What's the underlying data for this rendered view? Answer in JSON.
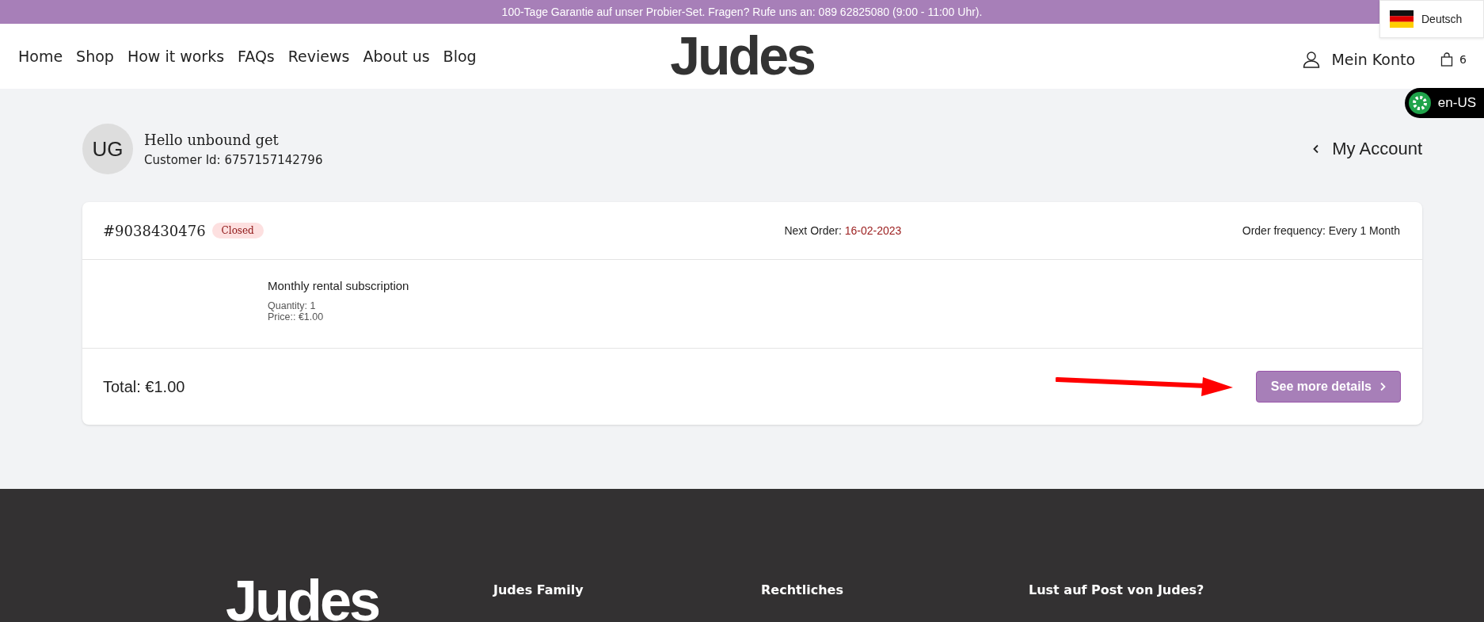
{
  "announcement": "100-Tage Garantie auf unser Probier-Set. Fragen? Rufe uns an: 089 62825080 (9:00 - 11:00 Uhr).",
  "language_switcher": {
    "label": "Deutsch"
  },
  "nav": [
    "Home",
    "Shop",
    "How it works",
    "FAQs",
    "Reviews",
    "About us",
    "Blog"
  ],
  "logo": "Judes",
  "account_link": "Mein Konto",
  "cart_count": "6",
  "locale_badge": "en-US",
  "profile": {
    "initials": "UG",
    "greeting": "Hello unbound get",
    "customer_id": "Customer Id: 6757157142796"
  },
  "back_link": "My Account",
  "order": {
    "number": "#9038430476",
    "status": "Closed",
    "next_order_label": "Next Order:",
    "next_order_date": "16-02-2023",
    "frequency": "Order frequency: Every 1 Month",
    "product": "Monthly rental subscription",
    "quantity": "Quantity: 1",
    "price": "Price:: €1.00",
    "total": "Total: €1.00",
    "details_button": "See more details"
  },
  "footer": {
    "logo": "Judes",
    "columns": [
      "Judes Family",
      "Rechtliches",
      "Lust auf Post von Judes?"
    ]
  }
}
